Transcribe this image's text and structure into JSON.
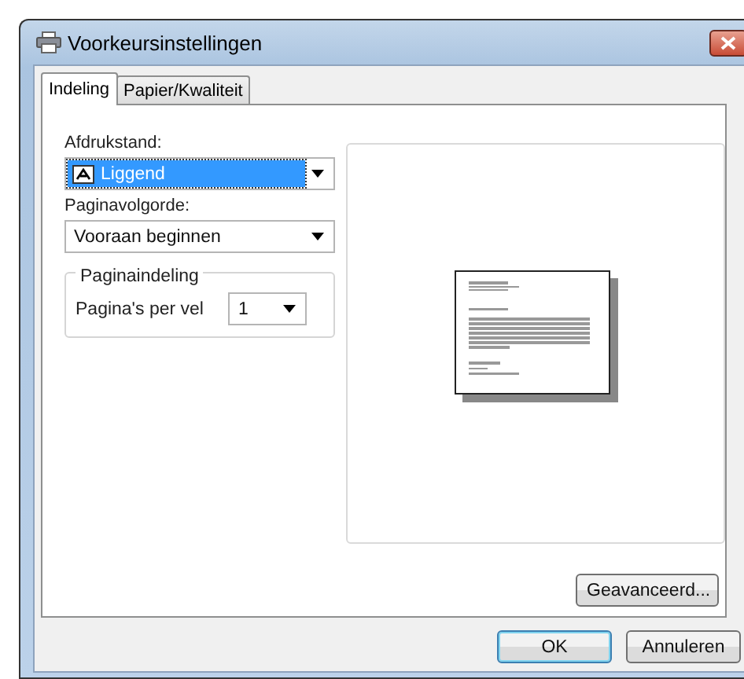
{
  "window": {
    "title": "Voorkeursinstellingen"
  },
  "tabs": [
    {
      "label": "Indeling",
      "selected": true
    },
    {
      "label": "Papier/Kwaliteit",
      "selected": false
    }
  ],
  "orientation": {
    "label": "Afdrukstand:",
    "value": "Liggend",
    "focused": true
  },
  "page_order": {
    "label": "Paginavolgorde:",
    "value": "Vooraan beginnen"
  },
  "layout_group": {
    "title": "Paginaindeling",
    "pages_per_sheet": {
      "label": "Pagina's per vel",
      "value": "1"
    }
  },
  "advanced_button": "Geavanceerd...",
  "buttons": [
    {
      "label": "OK",
      "default": true
    },
    {
      "label": "Annuleren",
      "default": false
    }
  ]
}
